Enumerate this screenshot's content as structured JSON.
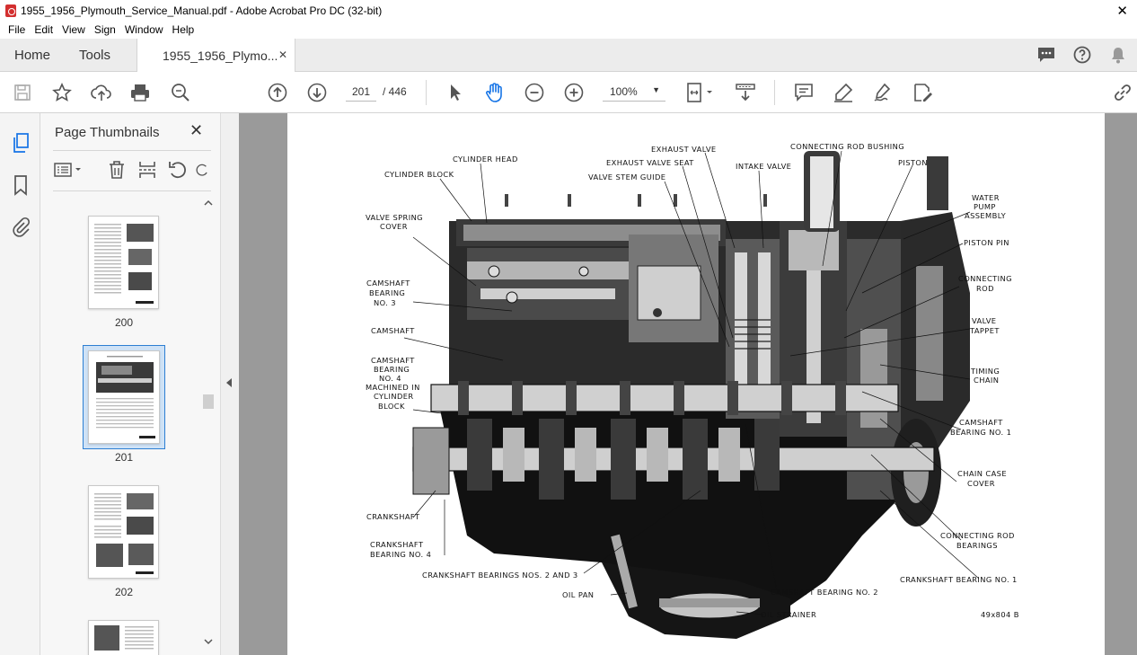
{
  "window": {
    "title": "1955_1956_Plymouth_Service_Manual.pdf - Adobe Acrobat Pro DC (32-bit)",
    "close_glyph": "✕"
  },
  "menu": [
    "File",
    "Edit",
    "View",
    "Sign",
    "Window",
    "Help"
  ],
  "tabs": {
    "home": "Home",
    "tools": "Tools",
    "document": "1955_1956_Plymo...",
    "close_glyph": "✕"
  },
  "toolbar": {
    "page_current": "201",
    "page_total": "/ 446",
    "zoom": "100%",
    "zoom_caret": "▼"
  },
  "thumbnails": {
    "title": "Page Thumbnails",
    "close_glyph": "✕",
    "pages": [
      {
        "label": "200",
        "selected": false
      },
      {
        "label": "201",
        "selected": true
      },
      {
        "label": "202",
        "selected": false
      },
      {
        "label": "",
        "selected": false
      }
    ]
  },
  "figure": {
    "labels": {
      "cylinder_head": "CYLINDER HEAD",
      "cylinder_block": "CYLINDER BLOCK",
      "valve_spring_cover_1": "VALVE SPRING",
      "valve_spring_cover_2": "COVER",
      "camshaft_bearing3_1": "CAMSHAFT",
      "camshaft_bearing3_2": "BEARING",
      "camshaft_bearing3_3": "NO. 3",
      "camshaft": "CAMSHAFT",
      "camshaft_bearing4_1": "CAMSHAFT",
      "camshaft_bearing4_2": "BEARING",
      "camshaft_bearing4_3": "NO. 4",
      "camshaft_bearing4_4": "MACHINED IN",
      "camshaft_bearing4_5": "CYLINDER",
      "camshaft_bearing4_6": "BLOCK",
      "crankshaft": "CRANKSHAFT",
      "crankshaft_bearing4_1": "CRANKSHAFT",
      "crankshaft_bearing4_2": "BEARING NO. 4",
      "crankshaft_bearings_2_3": "CRANKSHAFT BEARINGS NOS. 2 AND 3",
      "oil_pan": "OIL PAN",
      "oil_strainer": "OIL STRAINER",
      "camshaft_bearing2": "CAMSHAFT BEARING NO. 2",
      "crankshaft_bearing1": "CRANKSHAFT BEARING NO. 1",
      "exhaust_valve": "EXHAUST VALVE",
      "exhaust_valve_seat": "EXHAUST VALVE SEAT",
      "valve_stem_guide": "VALVE STEM GUIDE",
      "intake_valve": "INTAKE VALVE",
      "connecting_rod_bushing": "CONNECTING ROD BUSHING",
      "piston": "PISTON",
      "water_pump_1": "WATER",
      "water_pump_2": "PUMP",
      "water_pump_3": "ASSEMBLY",
      "piston_pin": "PISTON PIN",
      "connecting_rod_1": "CONNECTING",
      "connecting_rod_2": "ROD",
      "valve_tappet_1": "VALVE",
      "valve_tappet_2": "TAPPET",
      "timing_chain_1": "TIMING",
      "timing_chain_2": "CHAIN",
      "camshaft_bearing1_1": "CAMSHAFT",
      "camshaft_bearing1_2": "BEARING NO. 1",
      "chain_case_cover_1": "CHAIN CASE",
      "chain_case_cover_2": "COVER",
      "connecting_rod_bearings_1": "CONNECTING ROD",
      "connecting_rod_bearings_2": "BEARINGS",
      "figure_code": "49x804 B"
    }
  }
}
